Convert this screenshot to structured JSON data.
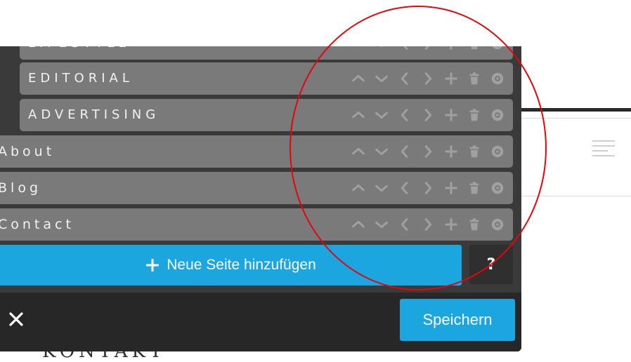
{
  "menu": {
    "items": [
      {
        "label": "LIFESTYLE",
        "level": 2
      },
      {
        "label": "EDITORIAL",
        "level": 2
      },
      {
        "label": "ADVERTISING",
        "level": 2
      },
      {
        "label": "About",
        "level": 1
      },
      {
        "label": "Blog",
        "level": 1
      },
      {
        "label": "Contact",
        "level": 1
      }
    ],
    "controls": [
      "move-up-icon",
      "move-down-icon",
      "outdent-icon",
      "indent-icon",
      "add-subpage-icon",
      "delete-icon",
      "visibility-eye-icon"
    ]
  },
  "add_page_button": {
    "label": "Neue Seite hinzufügen",
    "icon": "plus-icon"
  },
  "help_button": {
    "label": "?"
  },
  "footer": {
    "close_icon": "close-icon",
    "save_label": "Speichern"
  },
  "background": {
    "partial_heading": "KONTAKT"
  },
  "colors": {
    "panel": "#3a3a3a",
    "row": "#7a7a7a",
    "accent": "#1ca6e0",
    "footer": "#272727",
    "annotation_circle": "#e3060b"
  }
}
